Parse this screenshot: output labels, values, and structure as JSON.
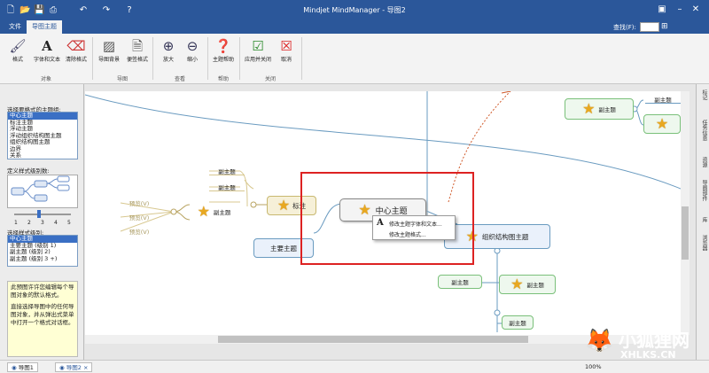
{
  "app": {
    "title": "Mindjet MindManager - 导图2"
  },
  "tabs": [
    {
      "label": "文件"
    },
    {
      "label": "导图主题"
    }
  ],
  "find": {
    "label": "查找(F):",
    "value": ""
  },
  "ribbon": {
    "buttons": [
      {
        "label": "格式",
        "icon": "brush-icon"
      },
      {
        "label": "字体和文本",
        "icon": "font-A-icon"
      },
      {
        "label": "清除格式",
        "icon": "eraser-icon"
      },
      {
        "label": "导图背景",
        "icon": "background-icon"
      },
      {
        "label": "便签格式",
        "icon": "note-icon"
      },
      {
        "label": "放大",
        "icon": "zoom-in-icon"
      },
      {
        "label": "缩小",
        "icon": "zoom-out-icon"
      },
      {
        "label": "主题帮助",
        "icon": "help-icon"
      },
      {
        "label": "应用并关闭",
        "icon": "check-icon"
      },
      {
        "label": "取消",
        "icon": "cancel-icon"
      }
    ],
    "groups": [
      {
        "label": "对象"
      },
      {
        "label": "导图"
      },
      {
        "label": "查看"
      },
      {
        "label": "帮助"
      },
      {
        "label": "关闭"
      }
    ]
  },
  "left_pane": {
    "select_label": "选择要格式的主题组:",
    "topic_groups": [
      "中心主题",
      "标注主题",
      "浮动主题",
      "浮动组织结构图主题",
      "组织结构图主题",
      "边界",
      "关系"
    ],
    "levels_label": "定义样式级别数:",
    "level_numbers": [
      "1",
      "2",
      "3",
      "4",
      "5"
    ],
    "level_value": 4,
    "style_label": "选择样式级别:",
    "style_levels": [
      "中心主题",
      "主要主题 (级别 1)",
      "副主题 (级别 2)",
      "副主题 (级别 3 +)"
    ],
    "help_text_1": "此预图许许您编辑每个导图对象的默认格式。",
    "help_text_2": "直接选择导图中的任何导图对象，并从弹出式菜单中打开一个格式对话框。"
  },
  "map": {
    "central": "中心主题",
    "main_topic": "主要主题",
    "callout": "标注",
    "org_chart": "组织结构图主题",
    "subtopics": [
      "副主题",
      "副主题",
      "副主题",
      "副主题",
      "副主题",
      "副主题",
      "副主题",
      "副主题"
    ],
    "previews": [
      "预览(V)",
      "预览(V)",
      "预览(V)"
    ]
  },
  "context_menu": {
    "items": [
      "修改主题字体和文本...",
      "修改主题格式..."
    ]
  },
  "right_tabs": [
    "标记",
    "任务信息",
    "资源",
    "导图部件",
    "库",
    "浏览器"
  ],
  "status": {
    "tabs": [
      "导图1",
      "导图2"
    ],
    "zoom": "100%"
  },
  "watermark": {
    "text": "小狐狸网",
    "sub": "XHLKS.CN"
  }
}
